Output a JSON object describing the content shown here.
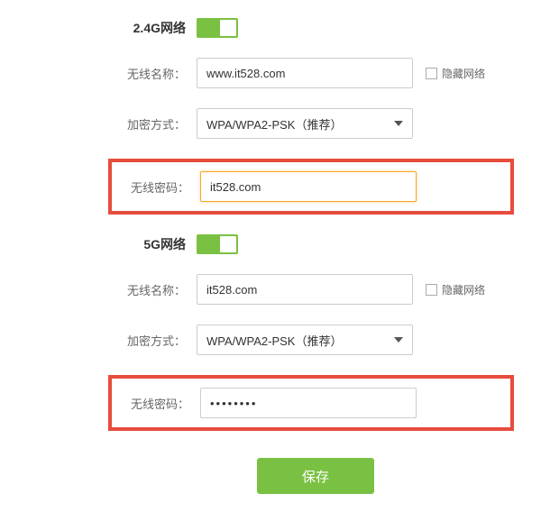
{
  "band24": {
    "title": "2.4G网络",
    "toggle_on": true,
    "ssid_label": "无线名称：",
    "ssid_value": "www.it528.com",
    "hide_label": "隐藏网络",
    "hide_checked": false,
    "encryption_label": "加密方式：",
    "encryption_value": "WPA/WPA2-PSK（推荐）",
    "password_label": "无线密码：",
    "password_value": "it528.com"
  },
  "band5": {
    "title": "5G网络",
    "toggle_on": true,
    "ssid_label": "无线名称：",
    "ssid_value": "it528.com",
    "hide_label": "隐藏网络",
    "hide_checked": false,
    "encryption_label": "加密方式：",
    "encryption_value": "WPA/WPA2-PSK（推荐）",
    "password_label": "无线密码：",
    "password_value": "••••••••"
  },
  "save_label": "保存"
}
